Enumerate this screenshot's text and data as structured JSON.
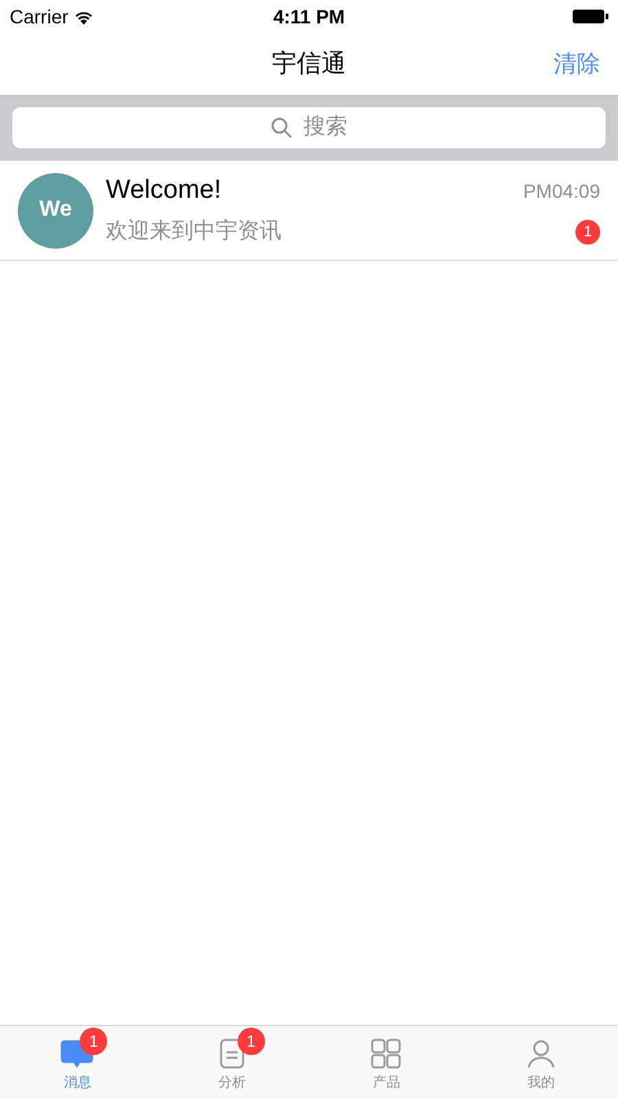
{
  "status_bar": {
    "carrier": "Carrier",
    "time": "4:11 PM"
  },
  "nav": {
    "title": "宇信通",
    "action": "清除"
  },
  "search": {
    "placeholder": "搜索"
  },
  "messages": [
    {
      "avatar": "We",
      "title": "Welcome!",
      "subtitle": "欢迎来到中宇资讯",
      "time": "PM04:09",
      "badge": "1"
    }
  ],
  "tabs": [
    {
      "kind": "chat",
      "label": "消息",
      "selected": true,
      "badge": "1"
    },
    {
      "kind": "doc",
      "label": "分析",
      "selected": false,
      "badge": "1"
    },
    {
      "kind": "grid",
      "label": "产品",
      "selected": false
    },
    {
      "kind": "person",
      "label": "我的",
      "selected": false
    }
  ]
}
